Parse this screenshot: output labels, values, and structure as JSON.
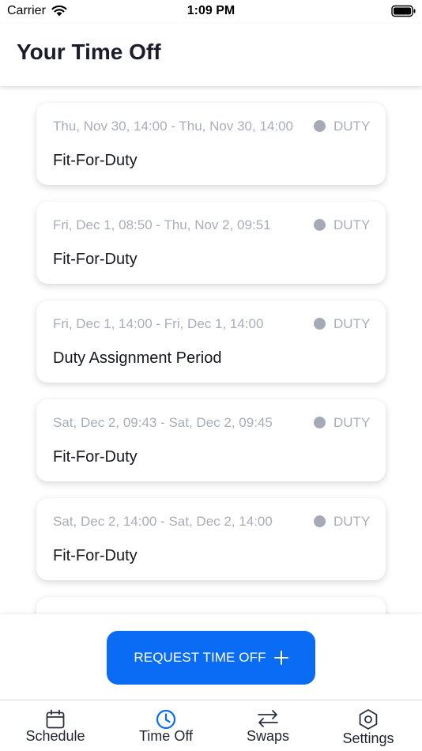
{
  "status_bar": {
    "carrier": "Carrier",
    "time": "1:09 PM"
  },
  "header": {
    "title": "Your Time Off"
  },
  "items": [
    {
      "range": "Thu, Nov 30, 14:00 - Thu, Nov 30, 14:00",
      "type": "DUTY",
      "title": "Fit-For-Duty"
    },
    {
      "range": "Fri, Dec 1, 08:50 - Thu, Nov 2, 09:51",
      "type": "DUTY",
      "title": "Fit-For-Duty"
    },
    {
      "range": "Fri, Dec 1, 14:00 - Fri, Dec 1, 14:00",
      "type": "DUTY",
      "title": "Duty Assignment Period"
    },
    {
      "range": "Sat, Dec 2, 09:43 - Sat, Dec 2, 09:45",
      "type": "DUTY",
      "title": "Fit-For-Duty"
    },
    {
      "range": "Sat, Dec 2, 14:00 - Sat, Dec 2, 14:00",
      "type": "DUTY",
      "title": "Fit-For-Duty"
    },
    {
      "range": "",
      "type": "",
      "title": ""
    }
  ],
  "action": {
    "request_label": "REQUEST TIME OFF"
  },
  "tabs": [
    {
      "label": "Schedule",
      "icon": "calendar-icon"
    },
    {
      "label": "Time Off",
      "icon": "clock-icon",
      "active": true
    },
    {
      "label": "Swaps",
      "icon": "swap-arrows-icon"
    },
    {
      "label": "Settings",
      "icon": "gear-icon"
    }
  ],
  "colors": {
    "accent": "#0a6cf5",
    "status_dot": "#a6a9b6",
    "muted_text": "#a9adbb"
  }
}
